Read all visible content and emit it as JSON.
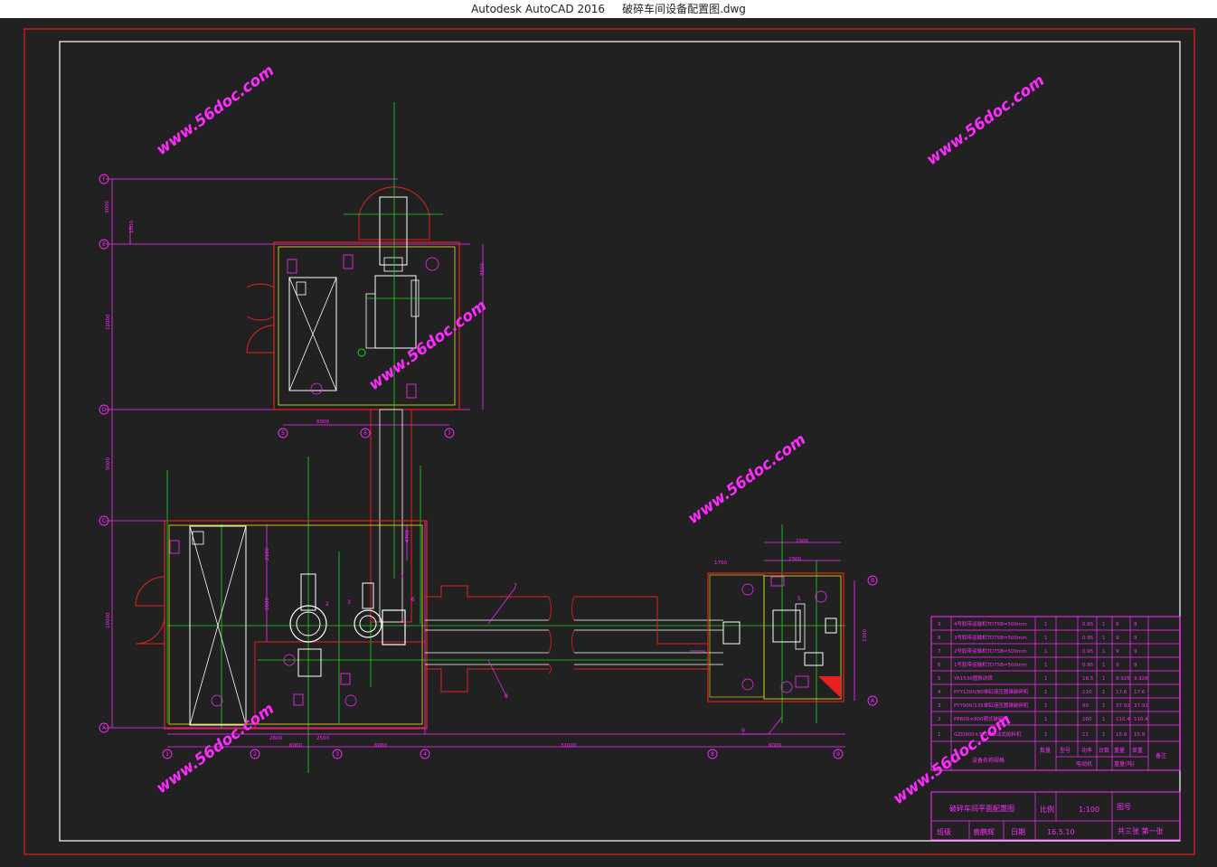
{
  "window": {
    "app": "Autodesk AutoCAD 2016",
    "file": "破碎车间设备配置图.dwg"
  },
  "watermark": "www.56doc.com",
  "colors": {
    "background": "#212121",
    "border_red": "#e0201c",
    "frame_white": "#ffffff",
    "magenta": "#ff2bff",
    "green": "#1fd61f",
    "red": "#e6211f",
    "yellow": "#e8e81a"
  },
  "title_block": {
    "drawing_title": "破碎车间平面配置图",
    "scale_label": "比例",
    "scale_value": "1:100",
    "drawing_no_label": "图号",
    "designer_label": "班级",
    "designer_name": "袁鹏辉",
    "date_label": "日期",
    "date_value": "16.5.10",
    "sheet_info": "共三张 第一张"
  },
  "parts_list": {
    "header": {
      "name": "设备名称规格",
      "qty": "数量",
      "model": "型号",
      "power": "功率",
      "count": "台数",
      "weight": "重量",
      "unit_weight": "单重",
      "total": "重量(吨)",
      "motor": "电动机",
      "note": "备注"
    },
    "rows": [
      {
        "no": "9",
        "name": "4号胶带运输机TD75B=500mm",
        "qty": "1",
        "p": "0.95",
        "c": "1",
        "w": "9",
        "t": "9"
      },
      {
        "no": "8",
        "name": "3号胶带运输机TD75B=500mm",
        "qty": "1",
        "p": "0.95",
        "c": "1",
        "w": "9",
        "t": "9"
      },
      {
        "no": "7",
        "name": "2号胶带运输机TD75B=500mm",
        "qty": "1",
        "p": "0.95",
        "c": "1",
        "w": "9",
        "t": "9"
      },
      {
        "no": "6",
        "name": "1号胶带运输机TD75B=500mm",
        "qty": "1",
        "p": "0.95",
        "c": "1",
        "w": "9",
        "t": "9"
      },
      {
        "no": "5",
        "name": "YA1530圆振动筛",
        "qty": "1",
        "p": "18.5",
        "c": "1",
        "w": "9.926",
        "t": "9.926"
      },
      {
        "no": "4",
        "name": "PYY1200/80单缸液压圆锥破碎机",
        "qty": "1",
        "p": "110",
        "c": "1",
        "w": "17.6",
        "t": "17.6"
      },
      {
        "no": "3",
        "name": "PYY900/135单缸液压圆锥破碎机",
        "qty": "1",
        "p": "90",
        "c": "1",
        "w": "37.92",
        "t": "37.92"
      },
      {
        "no": "2",
        "name": "PE600×900颚式破碎机",
        "qty": "1",
        "p": "160",
        "c": "1",
        "w": "110.4",
        "t": "110.4"
      },
      {
        "no": "1",
        "name": "GZD900×3000振动式给料机",
        "qty": "1",
        "p": "11",
        "c": "1",
        "w": "15.9",
        "t": "15.9"
      }
    ]
  },
  "dimensions": {
    "top_6000": "6000",
    "bottom_6000a": "6000",
    "bottom_6000b": "6000",
    "bottom_2600": "2600",
    "bottom_2500": "2500",
    "bottom_31000": "31000",
    "right_6000": "6000",
    "right_2300a": "2300",
    "right_2300b": "2300",
    "right_1700": "1700",
    "v_3000": "3000",
    "v_1500": "1500",
    "v_12000": "12000",
    "v_9000": "9000",
    "v_10000": "10000",
    "v_8500": "8500",
    "v_2100": "2100",
    "v_5800": "5800",
    "v_4700": "4700",
    "v_1100": "1100"
  },
  "axis_labels": {
    "A": "A",
    "B": "B",
    "C": "C",
    "D": "D",
    "E": "E",
    "F": "F",
    "n1": "1",
    "n2": "2",
    "n3": "3",
    "n4": "4",
    "n5": "5",
    "n6": "6",
    "n7": "7",
    "n8": "8",
    "n9": "9"
  },
  "callouts": {
    "c1": "1",
    "c2": "2",
    "c3": "3",
    "c4": "4",
    "c5": "5",
    "c6": "6",
    "c7": "7",
    "c8": "8",
    "c9": "9"
  }
}
